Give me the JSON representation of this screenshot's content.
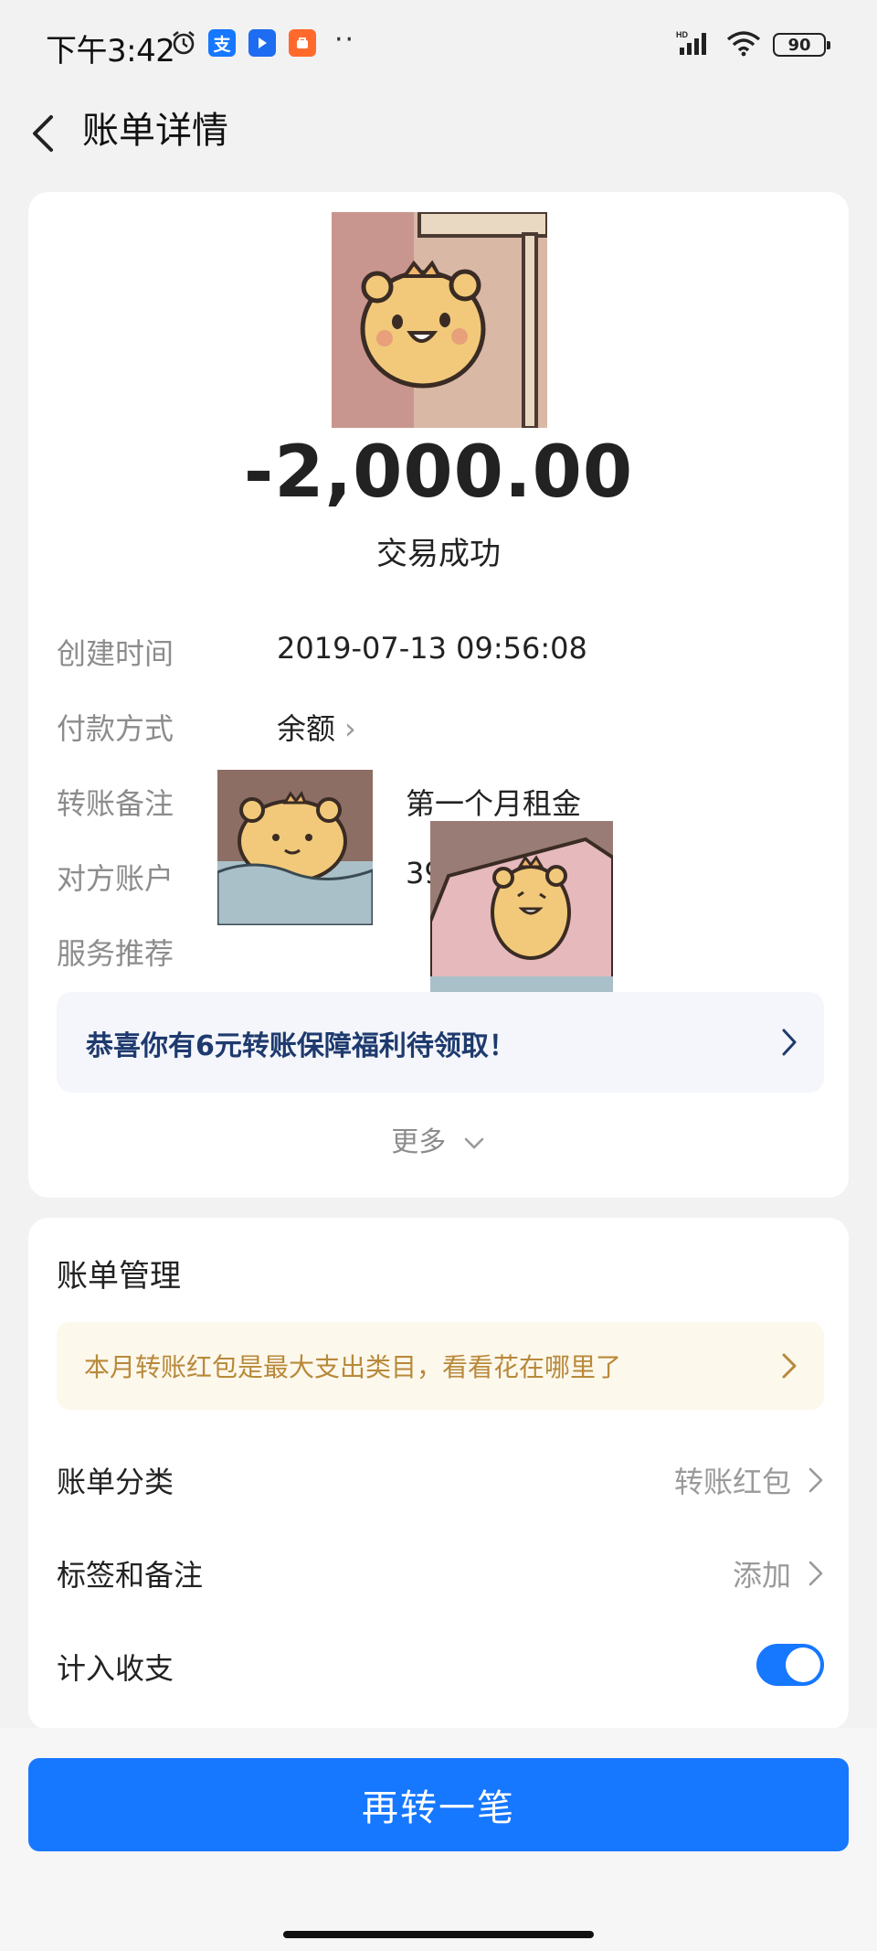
{
  "status_bar": {
    "time": "下午3:42",
    "alipay_glyph": "支",
    "more": "··",
    "battery": "90",
    "icons": [
      "alarm-icon",
      "alipay-app-icon",
      "blue-app-icon",
      "orange-app-icon",
      "signal-icon",
      "wifi-icon",
      "battery-icon"
    ]
  },
  "nav": {
    "title": "账单详情"
  },
  "summary": {
    "amount": "-2,000.00",
    "status": "交易成功"
  },
  "details": [
    {
      "label": "创建时间",
      "value": "2019-07-13 09:56:08"
    },
    {
      "label": "付款方式",
      "value": "余额"
    },
    {
      "label": "转账备注",
      "value": "第一个月租金"
    },
    {
      "label": "对方账户",
      "value": "392"
    },
    {
      "label": "服务推荐",
      "value": ""
    }
  ],
  "promo": {
    "text": "恭喜你有6元转账保障福利待领取！"
  },
  "more": "更多",
  "management": {
    "title": "账单管理",
    "tip": "本月转账红包是最大支出类目，看看花在哪里了",
    "rows": [
      {
        "label": "账单分类",
        "value": "转账红包"
      },
      {
        "label": "标签和备注",
        "value": "添加"
      }
    ],
    "toggle_row": {
      "label": "计入收支",
      "on": true
    }
  },
  "action": {
    "label": "再转一笔"
  },
  "colors": {
    "primary": "#1677ff",
    "promo_text": "#1e3a6e",
    "tip_text": "#b8893a"
  }
}
